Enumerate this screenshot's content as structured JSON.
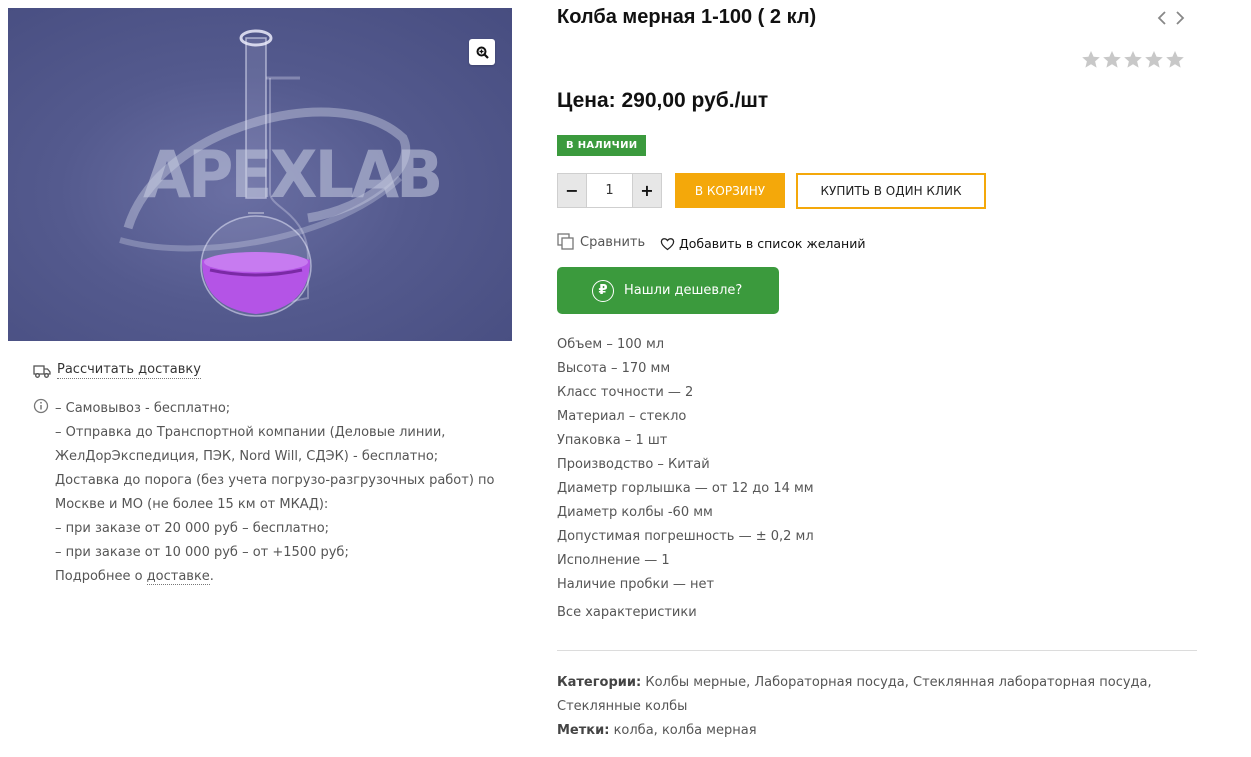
{
  "product": {
    "title": "Колба мерная 1-100 ( 2 кл)",
    "price": "Цена: 290,00 руб./шт",
    "stock_badge": "В НАЛИЧИИ",
    "rating": 0,
    "rating_max": 5
  },
  "image": {
    "logo_text": "APEXLAB"
  },
  "purchase": {
    "minus": "−",
    "quantity": "1",
    "plus": "+",
    "add_to_cart": "В КОРЗИНУ",
    "one_click": "КУПИТЬ В ОДИН КЛИК"
  },
  "actions": {
    "compare": "Сравнить",
    "wishlist": "Добавить в список желаний",
    "cheaper": "Нашли дешевле?",
    "cheaper_symbol": "₽"
  },
  "specs": [
    "Объем – 100 мл",
    "Высота – 170 мм",
    "Класс точности — 2",
    "Материал – стекло",
    "Упаковка – 1 шт",
    "Производство – Китай",
    "Диаметр горлышка — от 12 до 14 мм",
    "Диаметр колбы -60 мм",
    "Допустимая погрешность — ± 0,2 мл",
    "Исполнение — 1",
    "Наличие пробки — нет"
  ],
  "all_specs_link": "Все характеристики",
  "delivery": {
    "calc_link": "Рассчитать доставку",
    "lines": [
      "– Самовывоз - бесплатно;",
      "– Отправка до Транспортной компании (Деловые линии,",
      "ЖелДорЭкспедиция, ПЭК, Nord Will, СДЭК) - бесплатно;",
      "Доставка до порога (без учета погрузо-разгрузочных работ) по",
      "Москве и МО (не более 15 км от МКАД):",
      "– при заказе от 20 000 руб – бесплатно;",
      "– при заказе от 10 000 руб – от +1500 руб;"
    ],
    "more_prefix": "Подробнее о ",
    "more_link": "доставке",
    "more_suffix": "."
  },
  "meta": {
    "categories_label": "Категории:",
    "categories": [
      "Колбы мерные",
      "Лабораторная посуда",
      "Стеклянная лабораторная посуда",
      "Стеклянные колбы"
    ],
    "tags_label": "Метки:",
    "tags": [
      "колба",
      "колба мерная"
    ]
  },
  "colors": {
    "accent_orange": "#f4a80a",
    "green": "#3b9a3d",
    "star_gray": "#c8c8c8"
  },
  "icons": [
    "zoom-icon",
    "chevron-left-icon",
    "chevron-right-icon",
    "star-icon",
    "truck-icon",
    "info-icon",
    "compare-icon",
    "heart-icon",
    "ruble-icon"
  ]
}
